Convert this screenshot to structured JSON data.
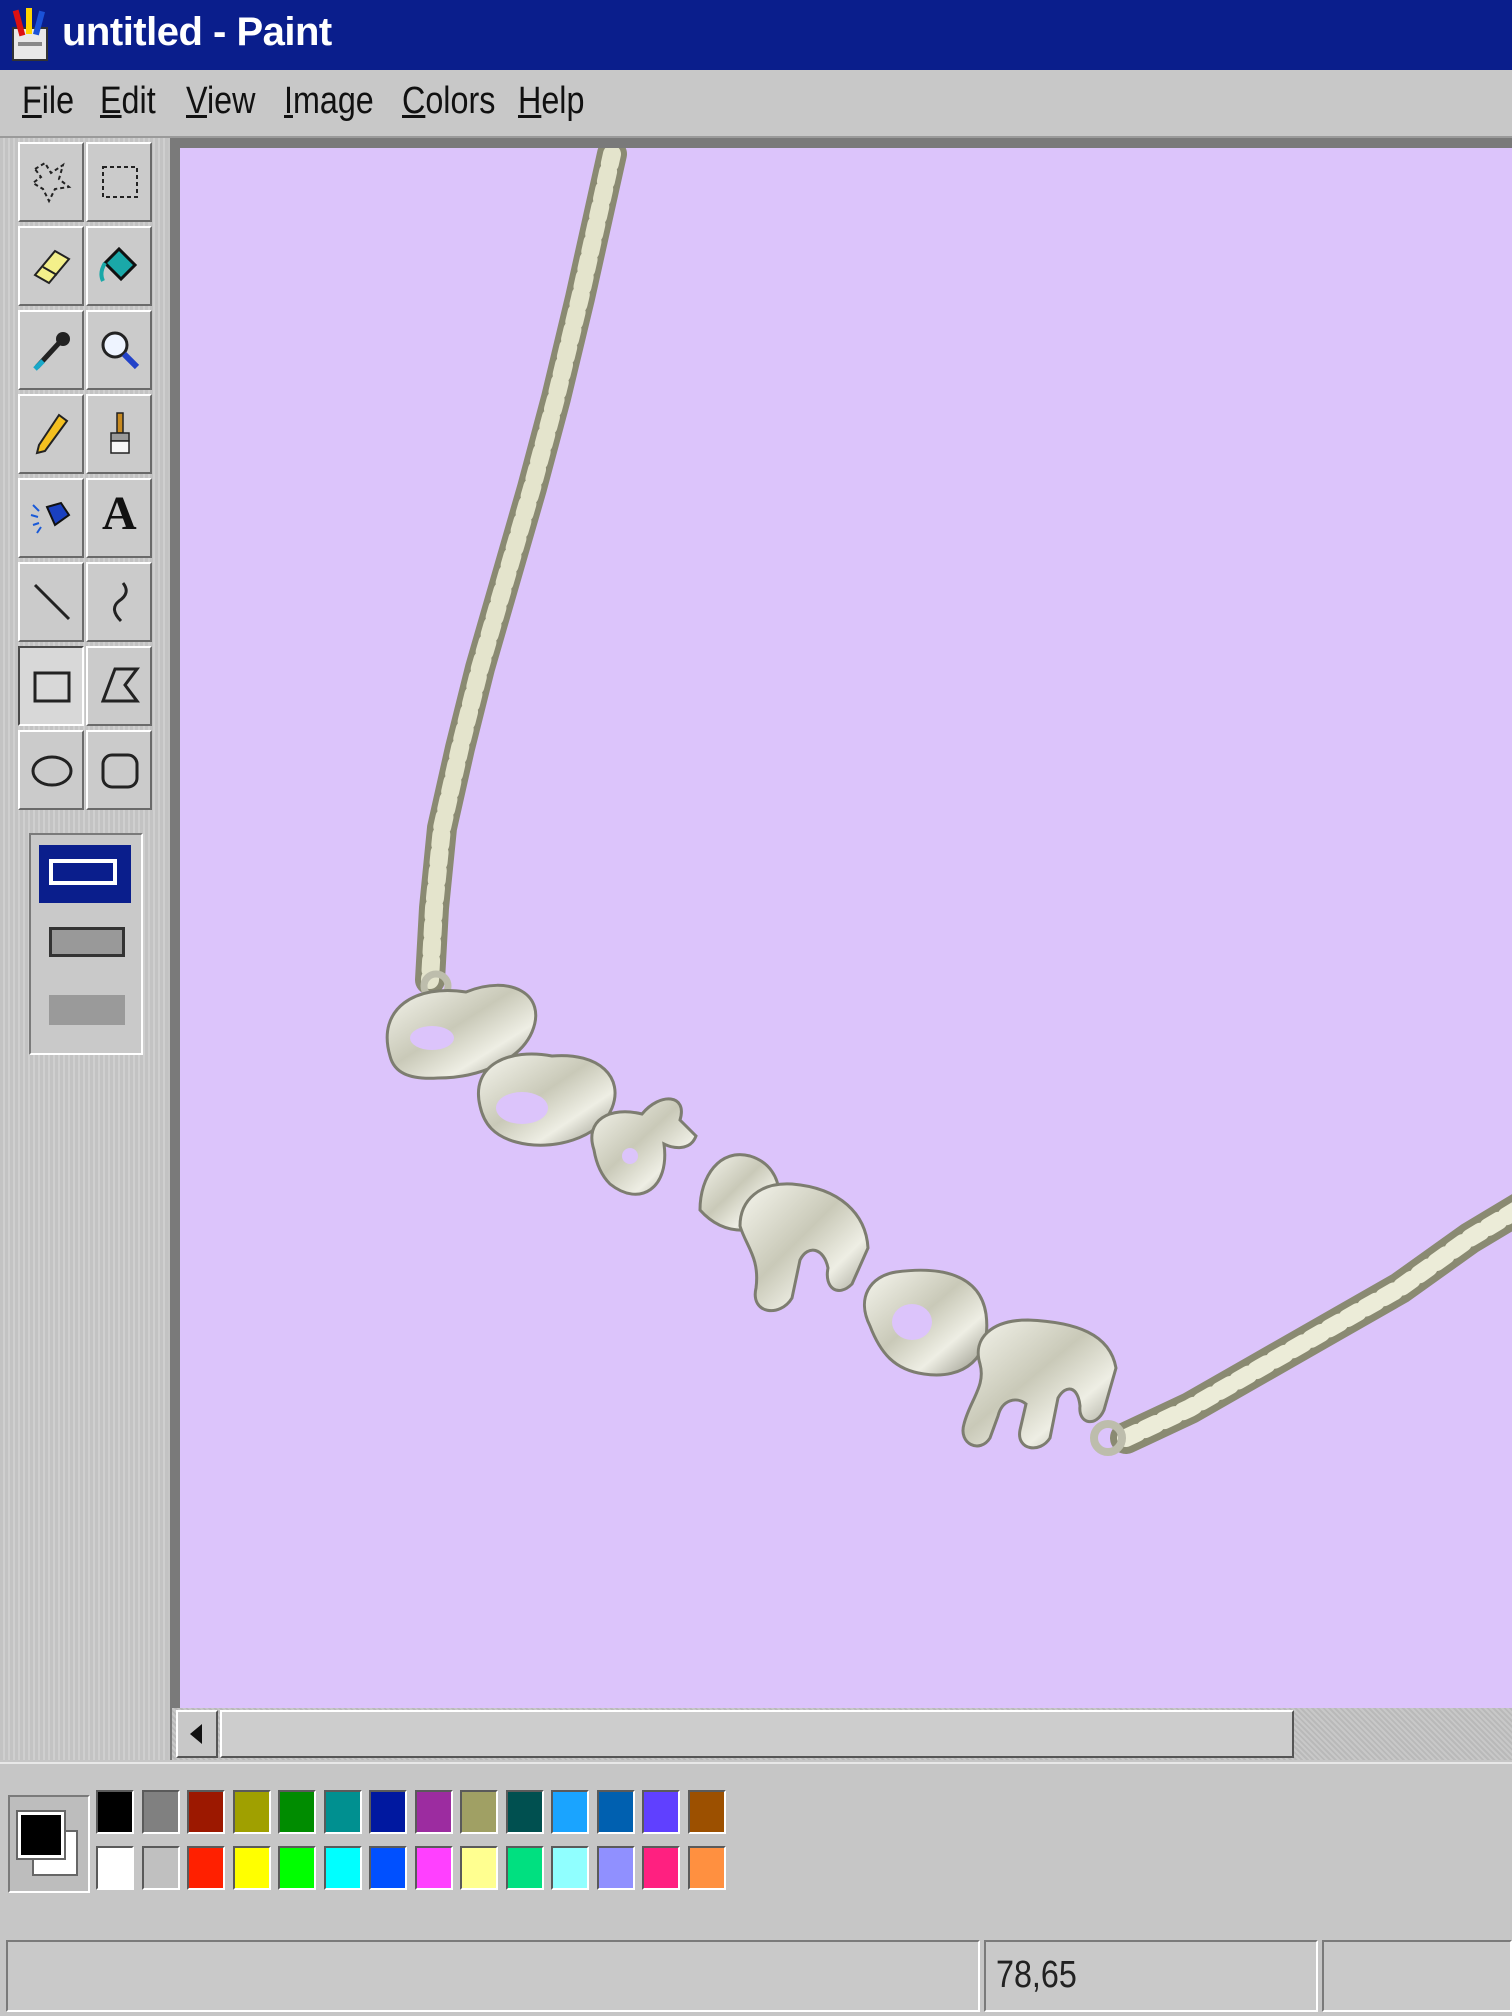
{
  "window": {
    "title": "untitled - Paint"
  },
  "menu": [
    "File",
    "Edit",
    "View",
    "Image",
    "Colors",
    "Help"
  ],
  "tools": [
    {
      "name": "free-form-select-icon"
    },
    {
      "name": "select-icon"
    },
    {
      "name": "eraser-icon"
    },
    {
      "name": "fill-bucket-icon"
    },
    {
      "name": "pick-color-icon"
    },
    {
      "name": "magnifier-icon"
    },
    {
      "name": "pencil-icon"
    },
    {
      "name": "brush-icon"
    },
    {
      "name": "airbrush-icon"
    },
    {
      "name": "text-icon",
      "glyph": "A"
    },
    {
      "name": "line-icon"
    },
    {
      "name": "curve-icon"
    },
    {
      "name": "rectangle-icon",
      "active": true
    },
    {
      "name": "polygon-icon"
    },
    {
      "name": "ellipse-icon"
    },
    {
      "name": "rounded-rectangle-icon"
    }
  ],
  "palette": {
    "foreground": "#000000",
    "background": "#ffffff",
    "top_row": [
      "#000000",
      "#808080",
      "#9c1800",
      "#a0a000",
      "#008c00",
      "#009090",
      "#0018a0",
      "#9c2ca0",
      "#a0a064",
      "#005050",
      "#1aa4ff",
      "#0060b0",
      "#6040ff",
      "#9c5000"
    ],
    "bottom_row": [
      "#ffffff",
      "#c0c0c0",
      "#ff2000",
      "#ffff00",
      "#00ff00",
      "#00ffff",
      "#0050ff",
      "#ff40ff",
      "#ffff90",
      "#00e080",
      "#90ffff",
      "#9090ff",
      "#ff2080",
      "#ff9040"
    ]
  },
  "canvas": {
    "background": "#dcc4fb"
  },
  "status": {
    "coordinates": "78,65"
  }
}
